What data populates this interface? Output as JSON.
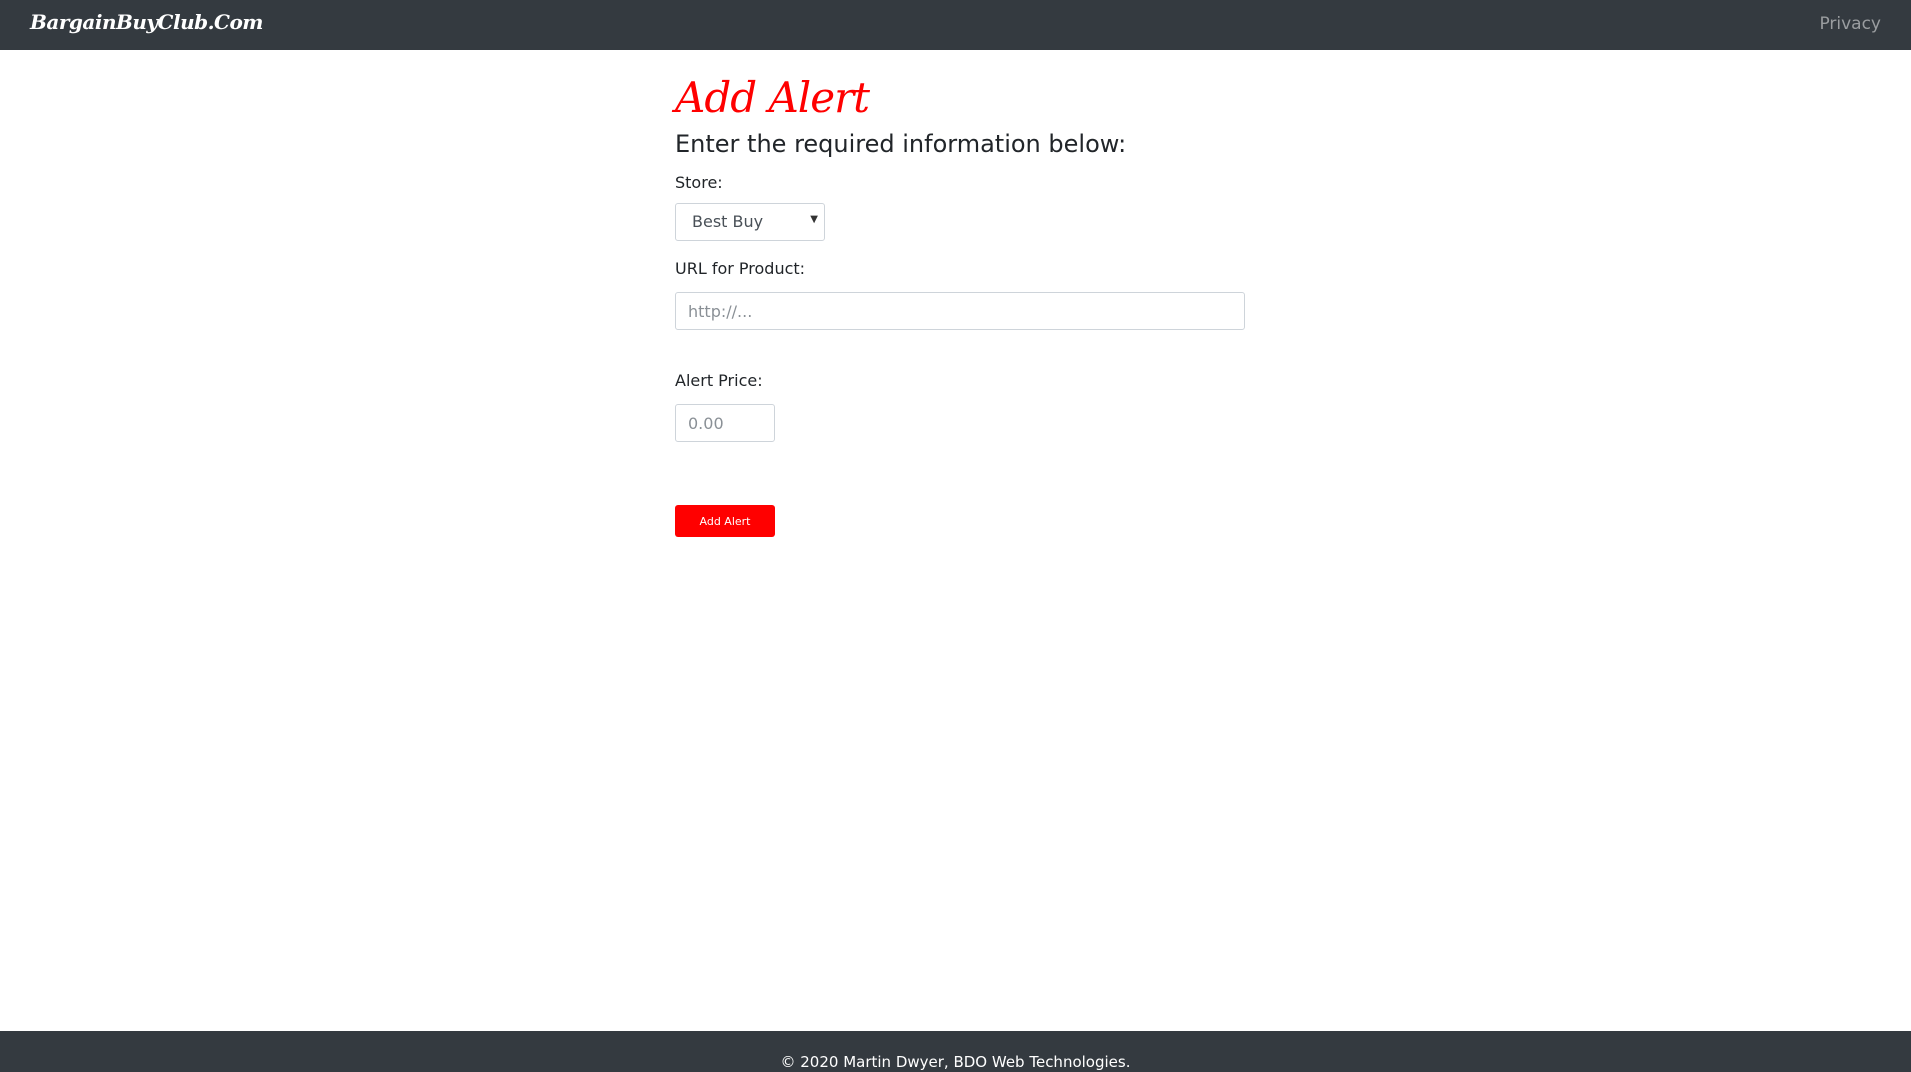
{
  "navbar": {
    "brand": "BargainBuyClub.Com",
    "links": [
      {
        "label": "Privacy"
      }
    ]
  },
  "main": {
    "title": "Add Alert",
    "subtitle": "Enter the required information below:",
    "store": {
      "label": "Store:",
      "selected": "Best Buy"
    },
    "url": {
      "label": "URL for Product:",
      "value": "",
      "placeholder": "http://..."
    },
    "price": {
      "label": "Alert Price:",
      "value": "",
      "placeholder": "0.00"
    },
    "submit_label": "Add Alert"
  },
  "footer": {
    "text": "© 2020 Martin Dwyer, BDO Web Technologies."
  },
  "colors": {
    "navbar_bg": "#343a40",
    "accent": "#ff0000",
    "nav_link": "#9a9da0"
  }
}
